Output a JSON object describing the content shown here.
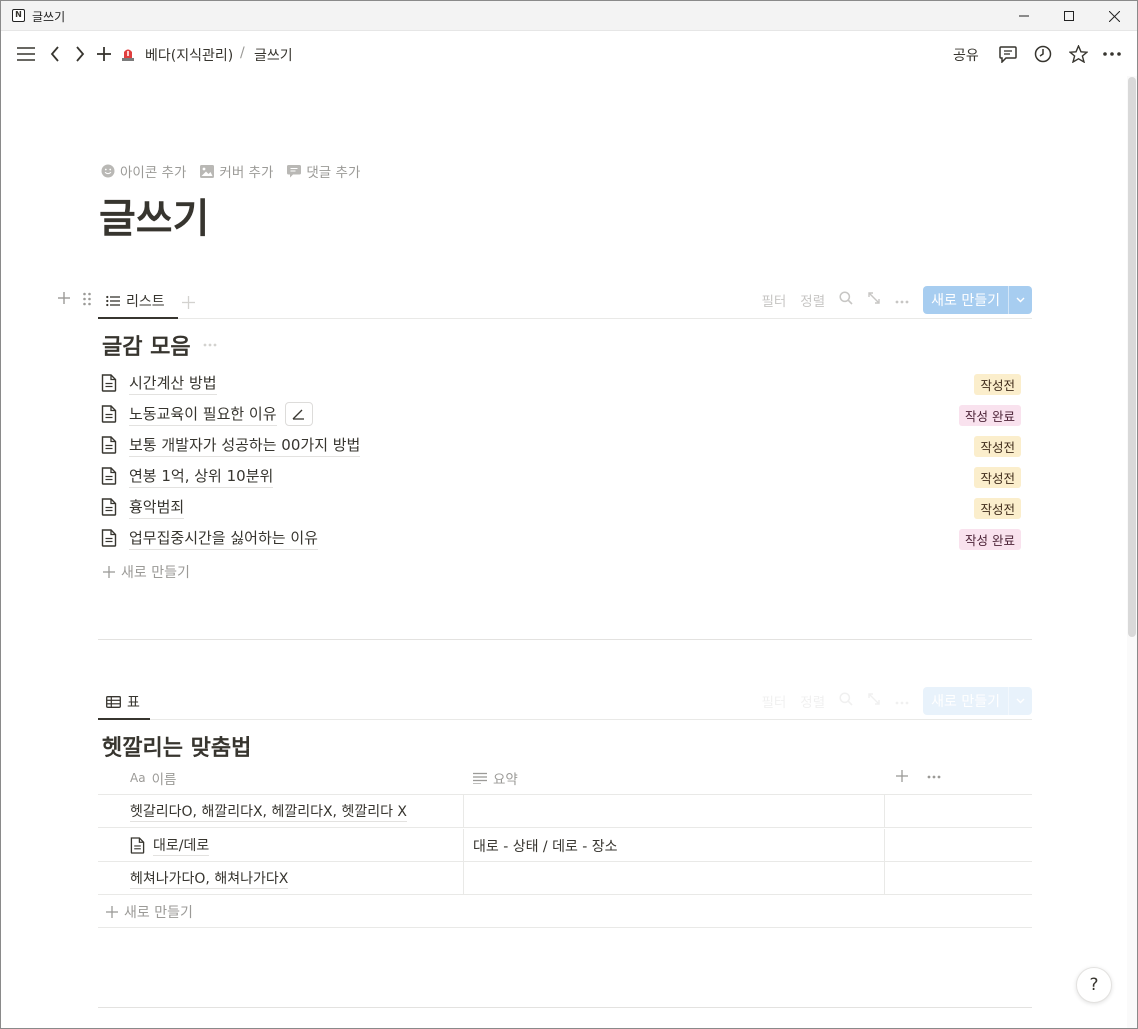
{
  "window": {
    "title": "글쓰기"
  },
  "toolbar": {
    "breadcrumb": [
      {
        "label": "베다(지식관리)"
      },
      {
        "separator": "/"
      },
      {
        "label": "글쓰기"
      }
    ],
    "share_label": "공유"
  },
  "page": {
    "actions": {
      "add_icon": "아이콘 추가",
      "add_cover": "커버 추가",
      "add_comment": "댓글 추가"
    },
    "title": "글쓰기"
  },
  "list_db": {
    "view_tab": "리스트",
    "controls": {
      "filter": "필터",
      "sort": "정렬",
      "new_button": "새로 만들기"
    },
    "title": "글감 모음",
    "items": [
      {
        "title": "시간계산 방법",
        "status": "작성전"
      },
      {
        "title": "노동교육이 필요한 이유",
        "status": "작성 완료"
      },
      {
        "title": "보통 개발자가 성공하는 00가지 방법",
        "status": "작성전"
      },
      {
        "title": "연봉 1억, 상위 10분위",
        "status": "작성전"
      },
      {
        "title": "흉악범죄",
        "status": "작성전"
      },
      {
        "title": "업무집중시간을 싫어하는 이유",
        "status": "작성 완료"
      }
    ],
    "add_new": "새로 만들기"
  },
  "table_db": {
    "view_tab": "표",
    "controls": {
      "filter": "필터",
      "sort": "정렬",
      "new_button": "새로 만들기"
    },
    "title": "헷깔리는 맞춤법",
    "columns": {
      "name": "이름",
      "summary": "요약",
      "name_icon_text": "Aa"
    },
    "rows": [
      {
        "name": "헷갈리다O, 해깔리다X, 헤깔리다X, 헷깔리다 X",
        "summary": ""
      },
      {
        "name": "대로/데로",
        "summary": "대로  - 상태 / 데로 - 장소"
      },
      {
        "name": "헤쳐나가다O, 해쳐나가다X",
        "summary": ""
      }
    ],
    "add_new": "새로 만들기"
  },
  "help": {
    "label": "?"
  },
  "colors": {
    "accent": "#a7cdf0",
    "badge_yellow": "#fbeecc",
    "badge_pink": "#f9e2ee",
    "text": "#37352f",
    "muted": "#9b9a97"
  }
}
